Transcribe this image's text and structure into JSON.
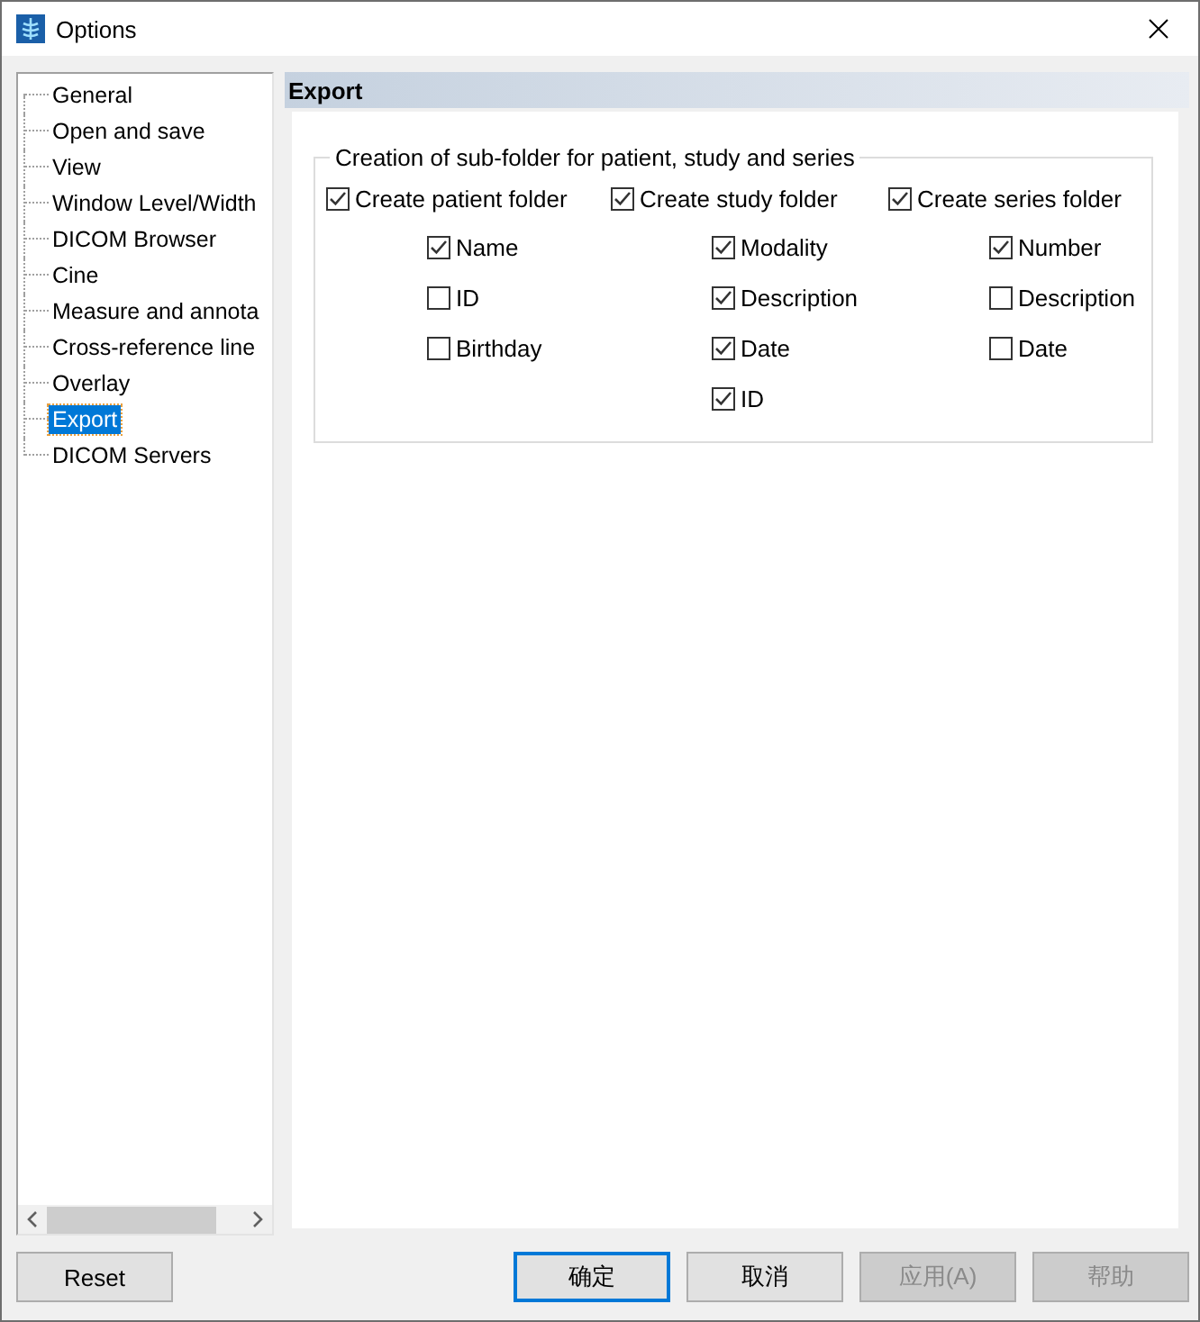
{
  "window": {
    "title": "Options"
  },
  "tree": {
    "items": [
      {
        "label": "General",
        "selected": false
      },
      {
        "label": "Open and save",
        "selected": false
      },
      {
        "label": "View",
        "selected": false
      },
      {
        "label": "Window Level/Width",
        "selected": false
      },
      {
        "label": "DICOM Browser",
        "selected": false
      },
      {
        "label": "Cine",
        "selected": false
      },
      {
        "label": "Measure and annota",
        "selected": false
      },
      {
        "label": "Cross-reference line",
        "selected": false
      },
      {
        "label": "Overlay",
        "selected": false
      },
      {
        "label": "Export",
        "selected": true
      },
      {
        "label": "DICOM Servers",
        "selected": false
      }
    ]
  },
  "panel": {
    "title": "Export",
    "group": {
      "title": "Creation of sub-folder for patient, study and series",
      "columns": [
        {
          "label": "Create patient folder",
          "checked": true,
          "options": [
            {
              "label": "Name",
              "checked": true
            },
            {
              "label": "ID",
              "checked": false
            },
            {
              "label": "Birthday",
              "checked": false
            }
          ]
        },
        {
          "label": "Create study folder",
          "checked": true,
          "options": [
            {
              "label": "Modality",
              "checked": true
            },
            {
              "label": "Description",
              "checked": true
            },
            {
              "label": "Date",
              "checked": true
            },
            {
              "label": "ID",
              "checked": true
            }
          ]
        },
        {
          "label": "Create series folder",
          "checked": true,
          "options": [
            {
              "label": "Number",
              "checked": true
            },
            {
              "label": "Description",
              "checked": false
            },
            {
              "label": "Date",
              "checked": false
            }
          ]
        }
      ]
    }
  },
  "buttons": [
    {
      "label": "Reset",
      "kind": "left",
      "default": false,
      "disabled": false
    },
    {
      "label": "确定",
      "kind": "right",
      "default": true,
      "disabled": false
    },
    {
      "label": "取消",
      "kind": "right",
      "default": false,
      "disabled": false
    },
    {
      "label": "应用(A)",
      "kind": "right",
      "default": false,
      "disabled": true
    },
    {
      "label": "帮助",
      "kind": "right",
      "default": false,
      "disabled": true
    }
  ]
}
